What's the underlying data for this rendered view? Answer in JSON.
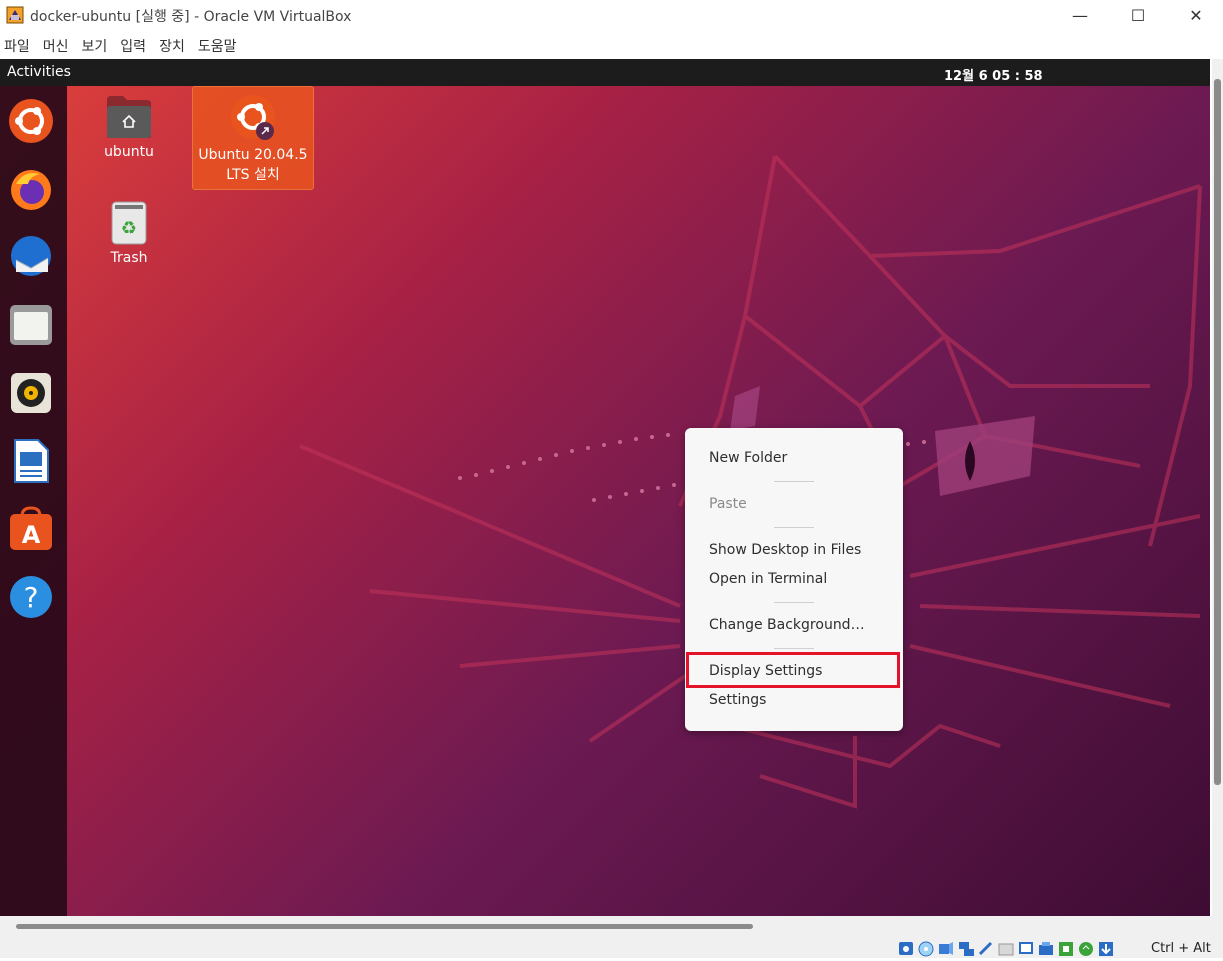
{
  "window": {
    "title": "docker-ubuntu [실행 중] - Oracle VM VirtualBox",
    "minimize_glyph": "—",
    "maximize_glyph": "☐",
    "close_glyph": "✕"
  },
  "menubar": {
    "items": [
      "파일",
      "머신",
      "보기",
      "입력",
      "장치",
      "도움말"
    ]
  },
  "topbar": {
    "activities": "Activities",
    "clock": "12월 6  05 : 58"
  },
  "dock": {
    "items": [
      "ubuntu-logo-icon",
      "firefox-icon",
      "thunderbird-icon",
      "files-icon",
      "rhythmbox-icon",
      "libreoffice-writer-icon",
      "software-center-icon",
      "help-icon"
    ]
  },
  "desktop": {
    "icons": [
      {
        "label": "ubuntu",
        "icon": "home-folder-icon"
      },
      {
        "label": "Ubuntu 20.04.5 LTS 설치",
        "line1": "Ubuntu 20.04.5",
        "line2": "LTS 설치",
        "icon": "ubuntu-installer-icon",
        "selected": true
      },
      {
        "label": "Trash",
        "icon": "trash-icon"
      }
    ]
  },
  "context_menu": {
    "items": [
      {
        "label": "New Folder",
        "enabled": true
      },
      {
        "label": "Paste",
        "enabled": false
      },
      {
        "label": "Show Desktop in Files",
        "enabled": true
      },
      {
        "label": "Open in Terminal",
        "enabled": true
      },
      {
        "label": "Change Background…",
        "enabled": true
      },
      {
        "label": "Display Settings",
        "enabled": true,
        "highlighted": true
      },
      {
        "label": "Settings",
        "enabled": true
      }
    ],
    "highlight_color": "#e5132a"
  },
  "statusbar": {
    "host_key": "Ctrl + Alt"
  },
  "colors": {
    "ubuntu_orange": "#e9541e",
    "topbar": "#1c1c1c",
    "menu_bg": "#f7f7f7"
  }
}
